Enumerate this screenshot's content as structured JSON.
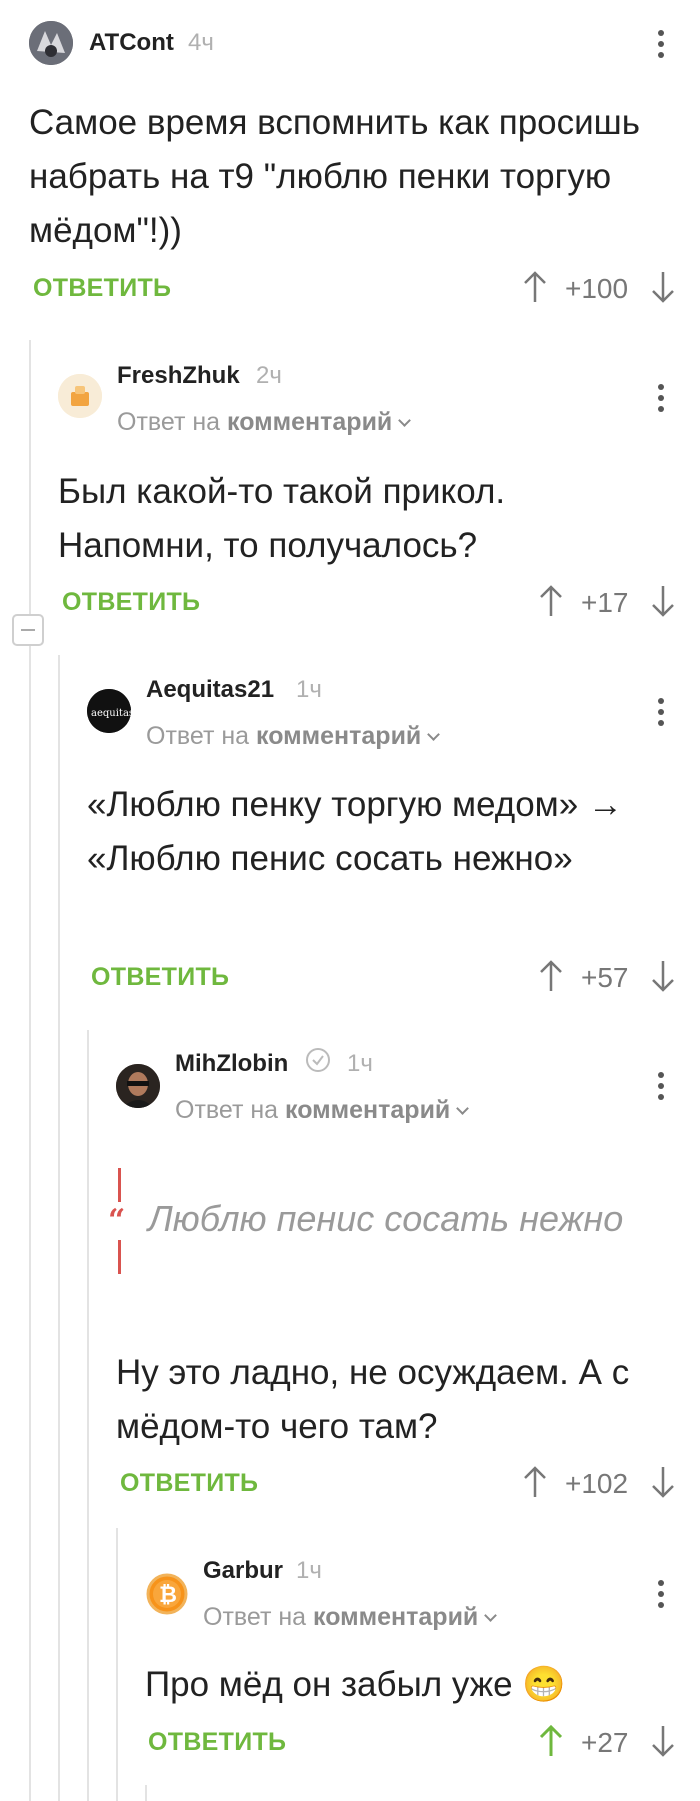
{
  "comments": [
    {
      "username": "ATCont",
      "time": "4ч",
      "text": "Самое время вспомнить как просишь набрать на т9 \"люблю пенки торгую мёдом\"!))",
      "reply_label": "ОТВЕТИТЬ",
      "rating": "+100"
    },
    {
      "username": "FreshZhuk",
      "time": "2ч",
      "reply_to_prefix": "Ответ на",
      "reply_to_target": "комментарий",
      "text": "Был какой-то такой прикол. Напомни, то получалось?",
      "reply_label": "ОТВЕТИТЬ",
      "rating": "+17"
    },
    {
      "username": "Aequitas21",
      "time": "1ч",
      "reply_to_prefix": "Ответ на",
      "reply_to_target": "комментарий",
      "text": "«Люблю пенку торгую медом» → «Люблю пенис сосать нежно»",
      "reply_label": "ОТВЕТИТЬ",
      "rating": "+57"
    },
    {
      "username": "MihZlobin",
      "time": "1ч",
      "reply_to_prefix": "Ответ на",
      "reply_to_target": "комментарий",
      "quote": "Люблю пенис сосать нежно",
      "text": "Ну это ладно, не осуждаем. А с мёдом-то чего там?",
      "reply_label": "ОТВЕТИТЬ",
      "rating": "+102"
    },
    {
      "username": "Garbur",
      "time": "1ч",
      "reply_to_prefix": "Ответ на",
      "reply_to_target": "комментарий",
      "text": "Про мёд он забыл уже 😁",
      "reply_label": "ОТВЕТИТЬ",
      "rating": "+27"
    }
  ],
  "colors": {
    "accent_green": "#6fb83e",
    "quote_red": "#d9534f",
    "upvoted_green": "#6fb83e"
  }
}
